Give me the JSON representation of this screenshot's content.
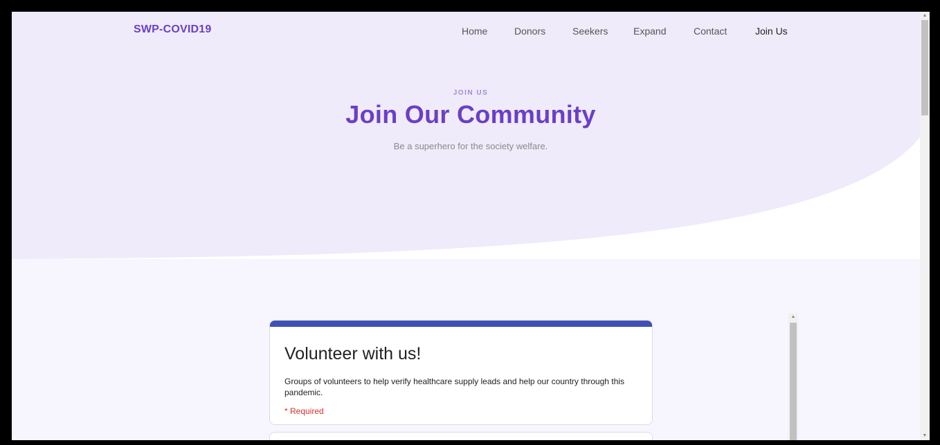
{
  "navbar": {
    "brand": "SWP-COVID19",
    "links": [
      {
        "label": "Home"
      },
      {
        "label": "Donors"
      },
      {
        "label": "Seekers"
      },
      {
        "label": "Expand"
      },
      {
        "label": "Contact"
      },
      {
        "label": "Join Us",
        "active": true
      }
    ]
  },
  "hero": {
    "eyebrow": "JOIN US",
    "title": "Join Our Community",
    "subtitle": "Be a superhero for the society welfare."
  },
  "form": {
    "title": "Volunteer with us!",
    "description": "Groups of volunteers to help verify healthcare supply leads and help our country through this pandemic.",
    "required_note": "* Required"
  },
  "colors": {
    "brand": "#6a3fc7",
    "hero_bg": "#efebfa",
    "page_bg": "#f7f5fd",
    "form_accent": "#3f51b5",
    "required": "#d93025"
  },
  "icons": {
    "scroll_up": "▲",
    "scroll_down": "▼"
  }
}
